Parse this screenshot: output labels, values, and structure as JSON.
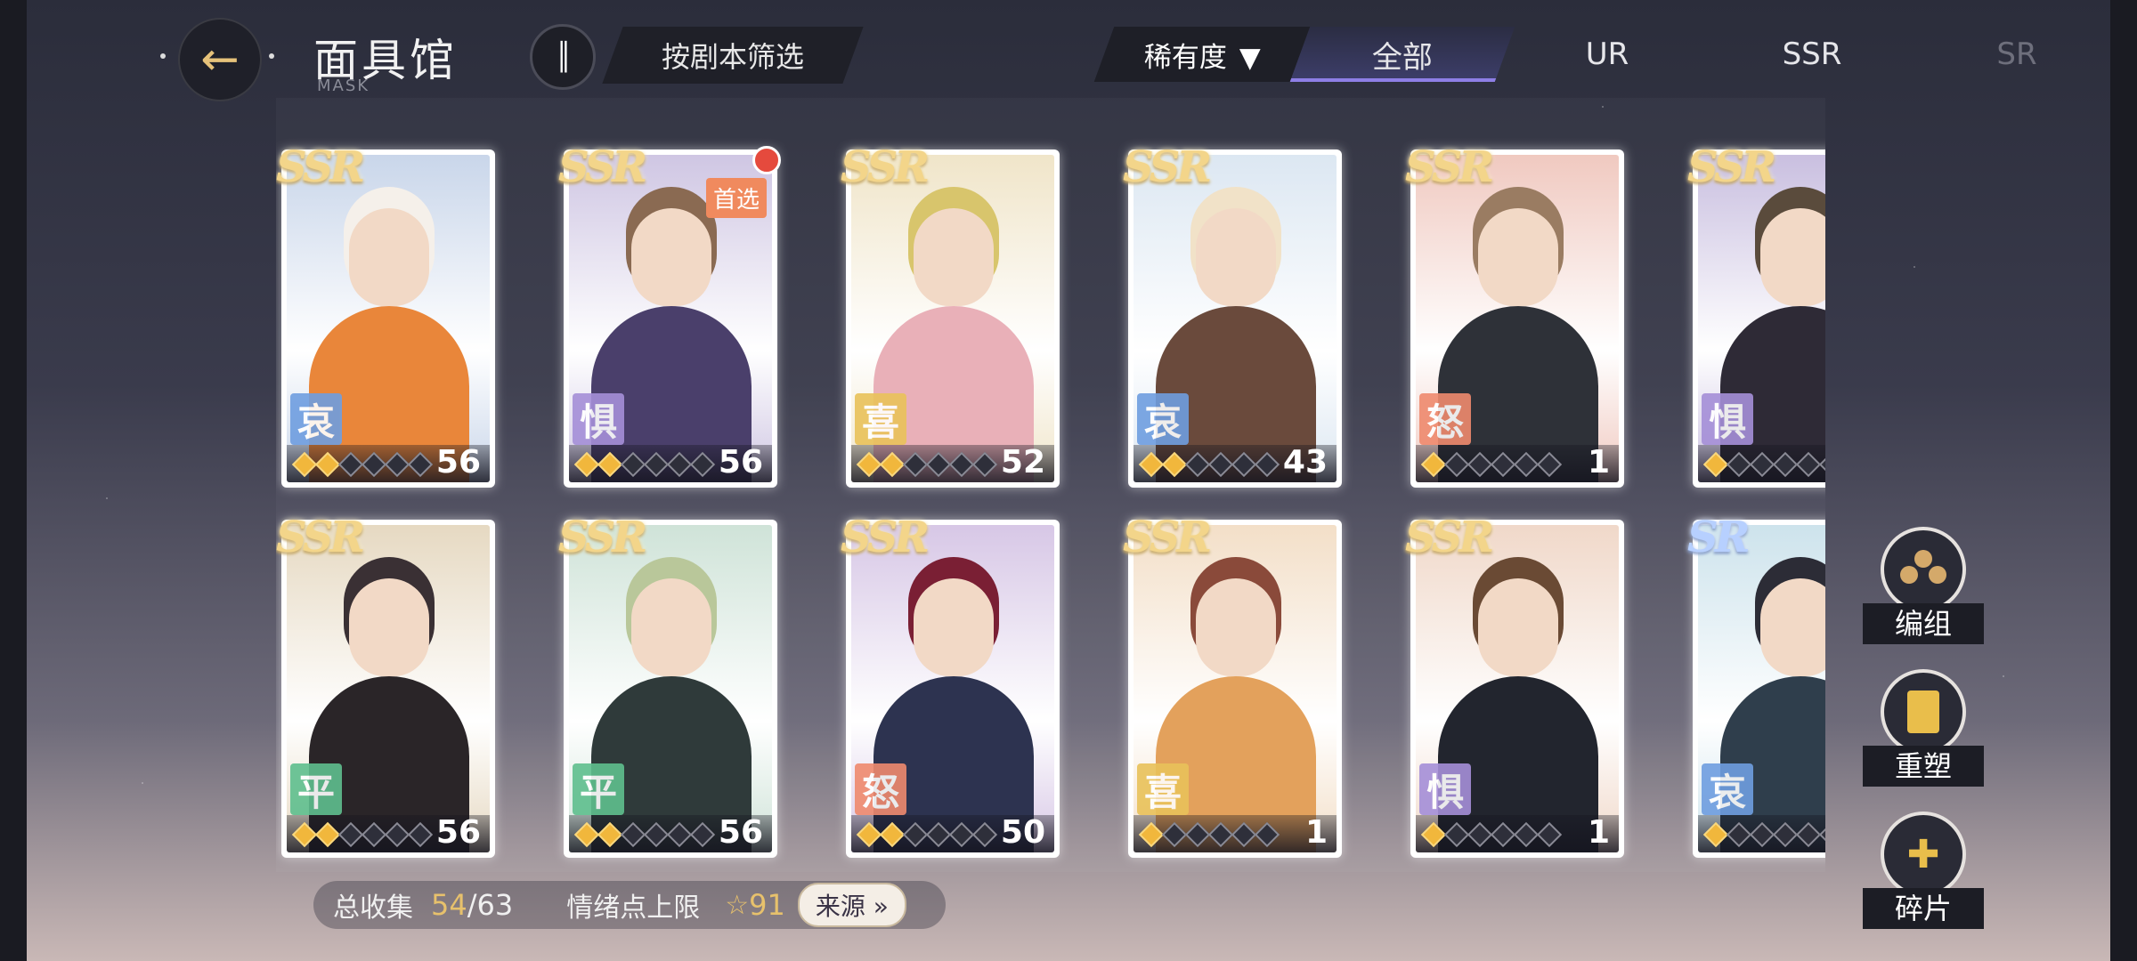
{
  "header": {
    "title": "面具馆",
    "subtitle": "MASK",
    "filter_label": "按剧本筛选",
    "rarity_label": "稀有度",
    "tabs": [
      "全部",
      "UR",
      "SSR",
      "SR"
    ],
    "active_tab": "全部"
  },
  "cards": [
    {
      "rarity": "SSR",
      "emotion": "哀",
      "level": "56",
      "stars": 2,
      "first": false
    },
    {
      "rarity": "SSR",
      "emotion": "惧",
      "level": "56",
      "stars": 2,
      "first": true,
      "first_label": "首选"
    },
    {
      "rarity": "SSR",
      "emotion": "喜",
      "level": "52",
      "stars": 2,
      "first": false
    },
    {
      "rarity": "SSR",
      "emotion": "哀",
      "level": "43",
      "stars": 2,
      "first": false
    },
    {
      "rarity": "SSR",
      "emotion": "怒",
      "level": "1",
      "stars": 1,
      "first": false
    },
    {
      "rarity": "SSR",
      "emotion": "惧",
      "level": "",
      "stars": 1,
      "first": false
    },
    {
      "rarity": "SSR",
      "emotion": "平",
      "level": "56",
      "stars": 2,
      "first": false
    },
    {
      "rarity": "SSR",
      "emotion": "平",
      "level": "56",
      "stars": 2,
      "first": false
    },
    {
      "rarity": "SSR",
      "emotion": "怒",
      "level": "50",
      "stars": 2,
      "first": false
    },
    {
      "rarity": "SSR",
      "emotion": "喜",
      "level": "1",
      "stars": 1,
      "first": false
    },
    {
      "rarity": "SSR",
      "emotion": "惧",
      "level": "1",
      "stars": 1,
      "first": false
    },
    {
      "rarity": "SR",
      "emotion": "哀",
      "level": "",
      "stars": 1,
      "first": false
    }
  ],
  "emotion_colors": {
    "哀": "#6f9ee0",
    "惧": "#a58fd8",
    "喜": "#e9c25a",
    "怒": "#ef8a6e",
    "平": "#5fbf8e"
  },
  "stats": {
    "collect_label": "总收集",
    "collect_current": "54",
    "collect_total": "/63",
    "emotion_label": "情绪点上限",
    "emotion_points": "91",
    "source_label": "来源 »"
  },
  "side_buttons": {
    "group": "编组",
    "reshape": "重塑",
    "fragments": "碎片"
  }
}
